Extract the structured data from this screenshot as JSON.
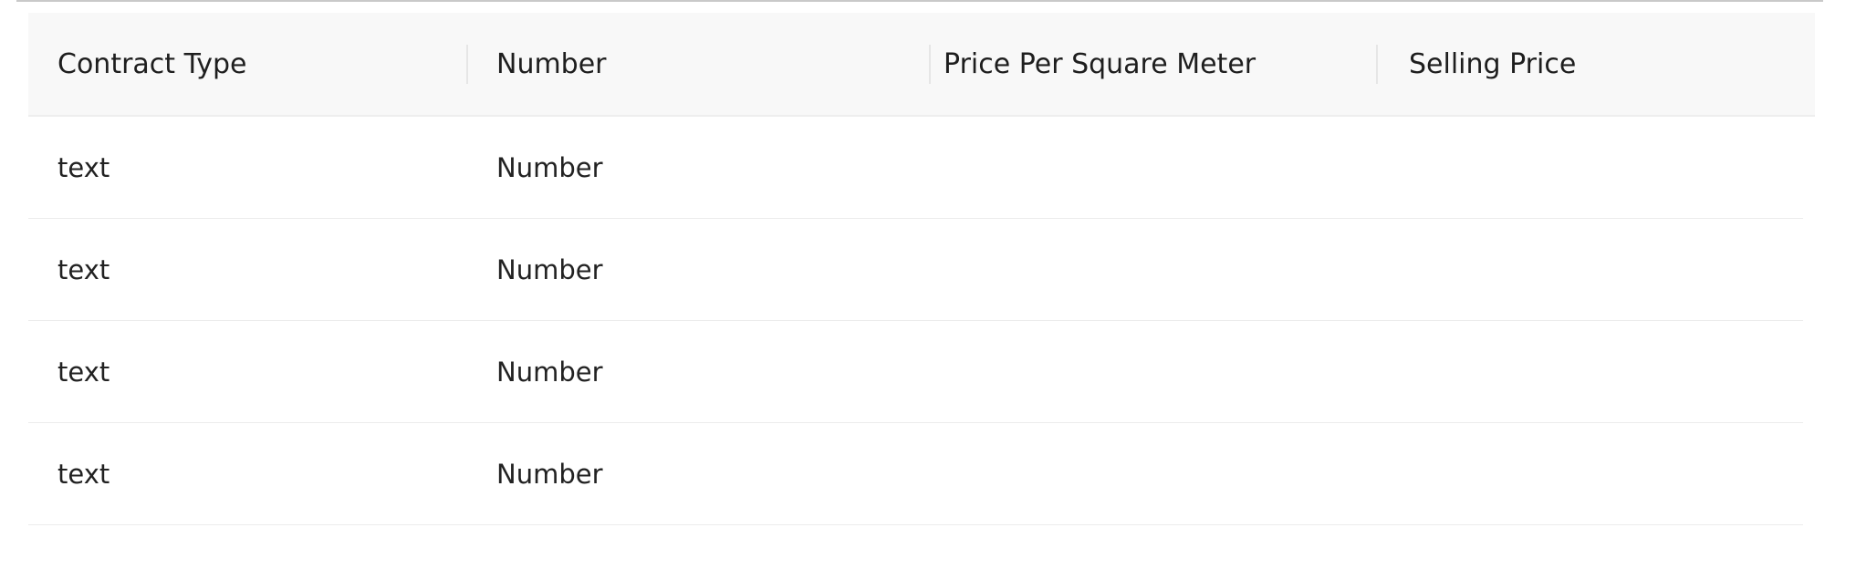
{
  "table": {
    "columns": [
      "Contract Type",
      "Number",
      "Price Per Square Meter",
      "Selling Price"
    ],
    "rows": [
      [
        "text",
        "Number",
        "",
        ""
      ],
      [
        "text",
        "Number",
        "",
        ""
      ],
      [
        "text",
        "Number",
        "",
        ""
      ],
      [
        "text",
        "Number",
        "",
        ""
      ]
    ]
  }
}
